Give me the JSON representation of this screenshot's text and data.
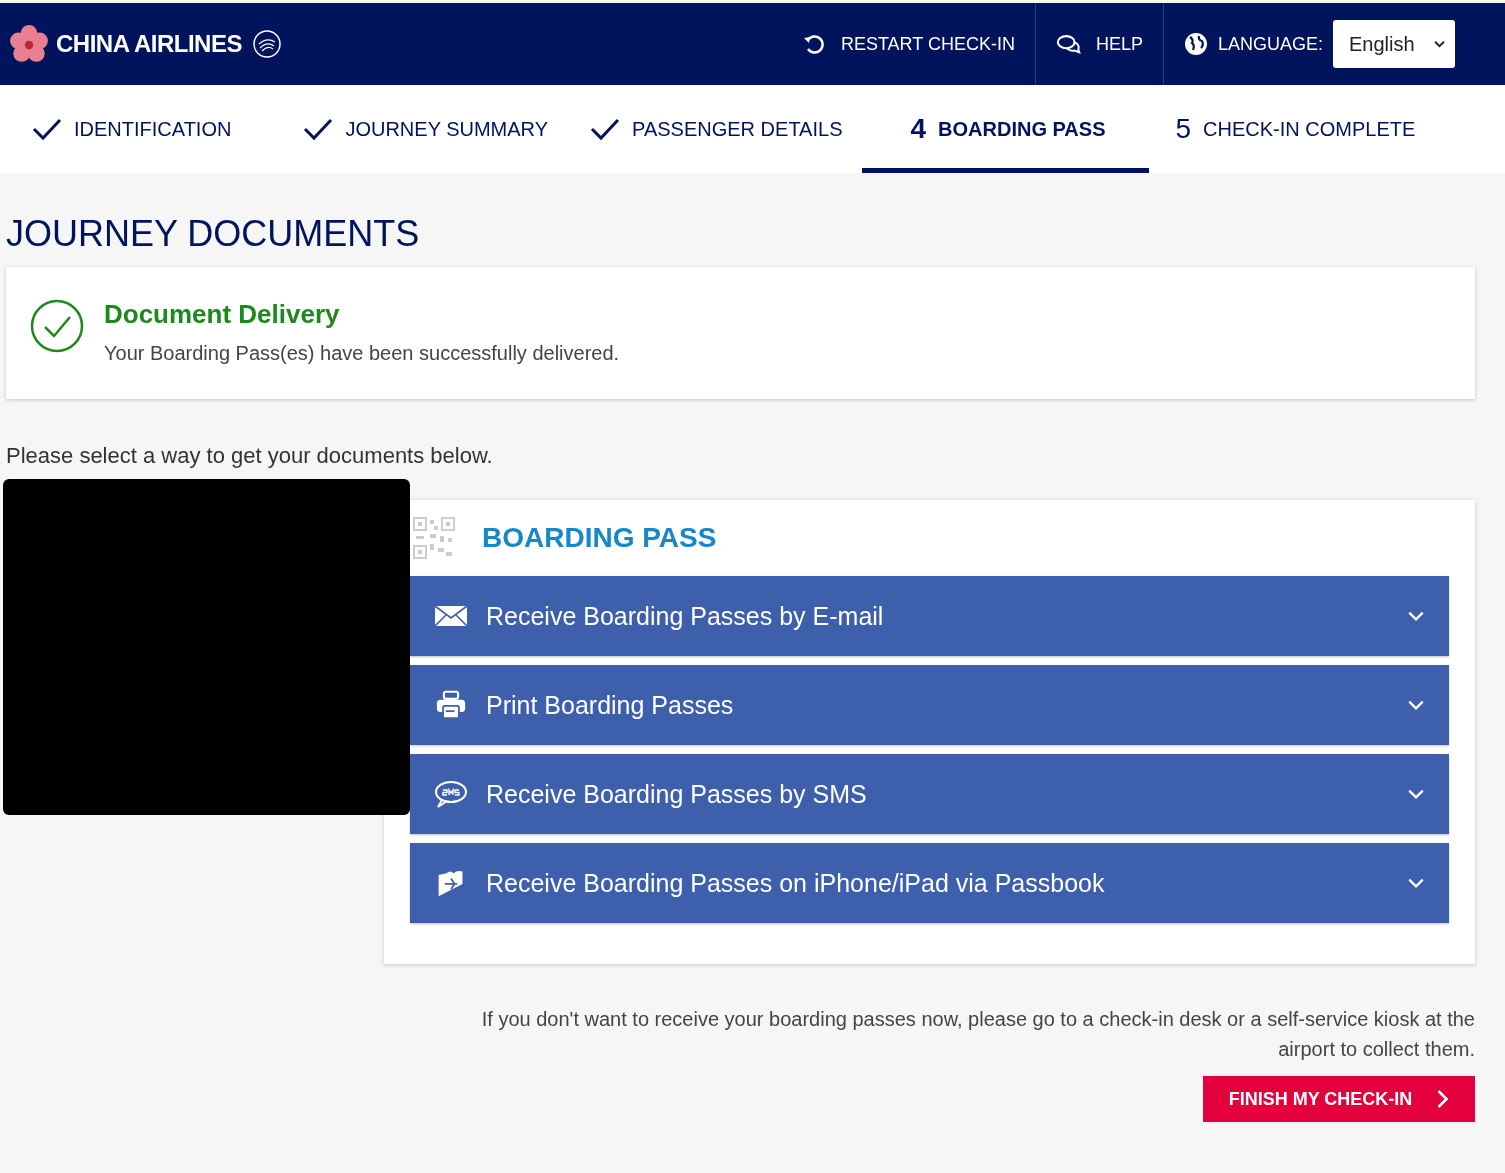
{
  "header": {
    "brand": "CHINA AIRLINES",
    "actions": [
      {
        "kind": "restart",
        "label": "RESTART CHECK-IN"
      },
      {
        "kind": "help",
        "label": "HELP"
      }
    ],
    "language": {
      "label": "LANGUAGE:",
      "value": "English"
    }
  },
  "steps": [
    {
      "label": "IDENTIFICATION",
      "completed": true,
      "selected": false
    },
    {
      "label": "JOURNEY SUMMARY",
      "completed": true,
      "selected": false
    },
    {
      "label": "PASSENGER DETAILS",
      "completed": true,
      "selected": false
    },
    {
      "number": "4",
      "label": "BOARDING PASS",
      "completed": false,
      "selected": true
    },
    {
      "number": "5",
      "label": "CHECK-IN COMPLETE",
      "completed": false,
      "selected": false
    }
  ],
  "page_title": "JOURNEY DOCUMENTS",
  "notice": {
    "title": "Document Delivery",
    "message": "Your Boarding Pass(es) have been successfully delivered."
  },
  "instruction": "Please select a way to get your documents below.",
  "boarding_pass": {
    "title": "BOARDING PASS",
    "options": [
      {
        "kind": "email",
        "label": "Receive Boarding Passes by E-mail",
        "expanded": false
      },
      {
        "kind": "print",
        "label": "Print Boarding Passes",
        "expanded": false
      },
      {
        "kind": "sms",
        "label": "Receive Boarding Passes by SMS",
        "expanded": false
      },
      {
        "kind": "passbook",
        "label": "Receive Boarding Passes on iPhone/iPad via Passbook",
        "expanded": false
      }
    ]
  },
  "footer_note": "If you don't want to receive your boarding passes now, please go to a check-in desk or a self-service kiosk at the airport to collect them.",
  "finish_button": "FINISH MY CHECK-IN"
}
